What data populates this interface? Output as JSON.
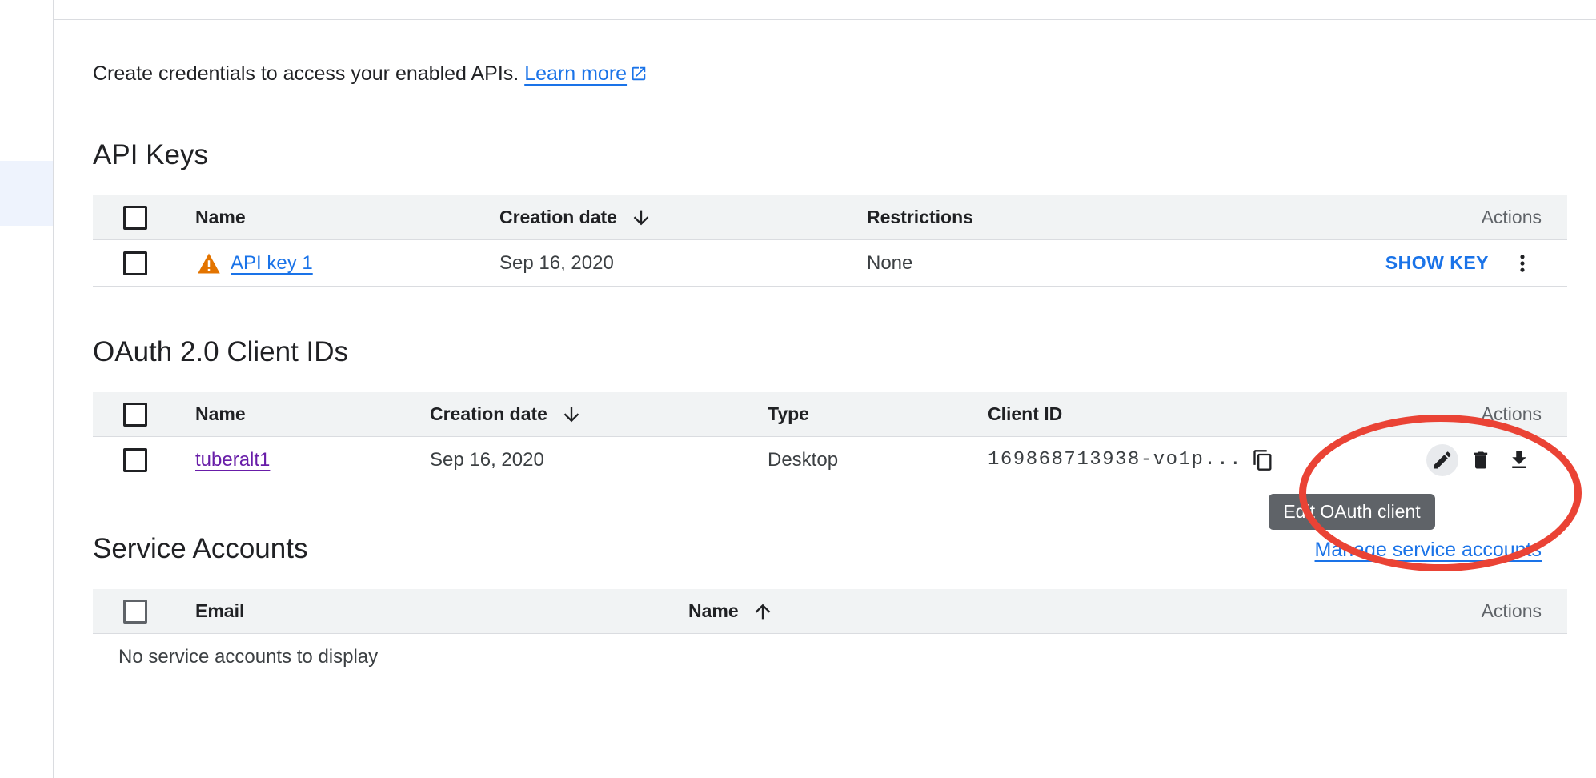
{
  "intro": {
    "text": "Create credentials to access your enabled APIs.",
    "learn_more": "Learn more"
  },
  "api_keys": {
    "title": "API Keys",
    "columns": {
      "name": "Name",
      "creation_date": "Creation date",
      "restrictions": "Restrictions",
      "actions": "Actions"
    },
    "rows": [
      {
        "name": "API key 1",
        "creation_date": "Sep 16, 2020",
        "restrictions": "None",
        "action_label": "SHOW KEY",
        "warning_icon": "warning-icon"
      }
    ]
  },
  "oauth": {
    "title": "OAuth 2.0 Client IDs",
    "columns": {
      "name": "Name",
      "creation_date": "Creation date",
      "type": "Type",
      "client_id": "Client ID",
      "actions": "Actions"
    },
    "rows": [
      {
        "name": "tuberalt1",
        "creation_date": "Sep 16, 2020",
        "type": "Desktop",
        "client_id": "169868713938-vo1p..."
      }
    ],
    "tooltip": "Edit OAuth client"
  },
  "service_accounts": {
    "title": "Service Accounts",
    "manage_link": "Manage service accounts",
    "columns": {
      "email": "Email",
      "name": "Name",
      "actions": "Actions"
    },
    "empty_text": "No service accounts to display"
  },
  "colors": {
    "link": "#1a73e8",
    "visited_link": "#681da8",
    "annotation": "#ea4335",
    "warning": "#e37400"
  }
}
